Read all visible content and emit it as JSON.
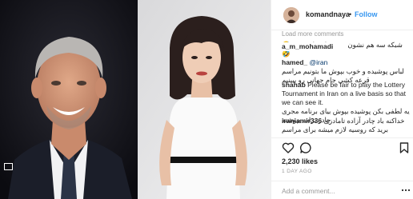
{
  "header": {
    "username": "komandnaya",
    "separator": "•",
    "follow_label": "Follow"
  },
  "comments": {
    "load_more_label": "Load more comments",
    "items": [
      {
        "user": "",
        "text": "شبکه سه هم نشون میده چادر بادت نره 🤣🤣"
      },
      {
        "user": "hamed_",
        "mention": "@iran",
        "text": "لباس پوشیده و خوب بپوش ما بتونیم مراسم قرعه کشی جام جهانی رو ببینیم"
      },
      {
        "user": "a_m_mohamadi",
        "text": ""
      },
      {
        "user": "shahab",
        "text": "Please be fair to play the Lottery Tournament in Iran on a live basis so that we can see it."
      },
      {
        "user": "",
        "text": "یه لطفی بکن پوشیده بپوش بیای برنامه مجری چادر برات بپوشند"
      },
      {
        "user": "iraniamir336",
        "text": "خداکنه باد چادر آزاده تامادزی برید که روسیه لازم میشه برای مراسم"
      }
    ]
  },
  "actions": {
    "like_icon": "heart-icon",
    "comment_icon": "comment-bubble-icon",
    "save_icon": "bookmark-icon"
  },
  "stats": {
    "likes": "2,230 likes",
    "time_ago": "1 DAY AGO"
  },
  "add_comment": {
    "placeholder": "Add a comment...",
    "more_icon": "more-options-icon"
  },
  "colors": {
    "follow": "#3897f0",
    "muted": "#999999",
    "border": "#efefef",
    "text": "#262626"
  }
}
